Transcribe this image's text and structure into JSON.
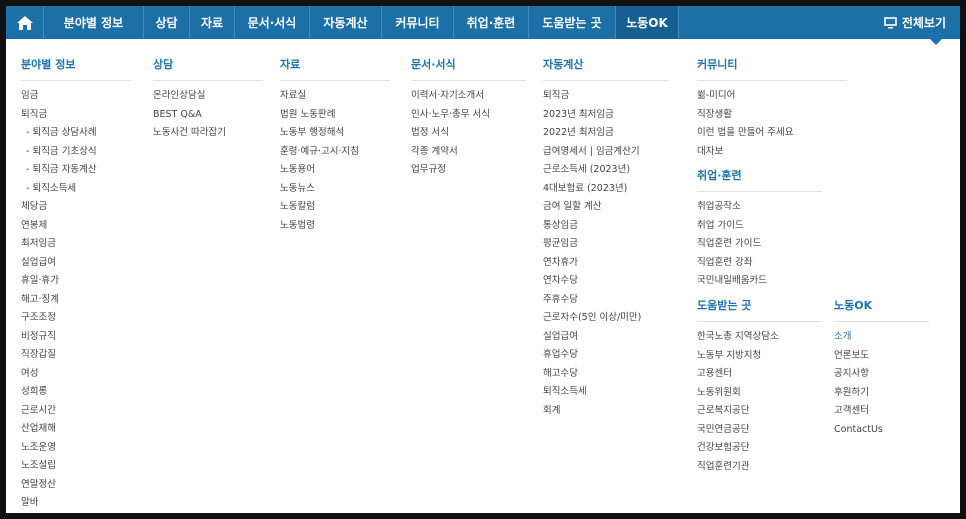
{
  "nav": {
    "items": [
      "분야별 정보",
      "상담",
      "자료",
      "문서·서식",
      "자동계산",
      "커뮤니티",
      "취업·훈련",
      "도움받는 곳",
      "노동OK"
    ],
    "full_view": "전체보기"
  },
  "menu": {
    "field": {
      "title": "분야별 정보",
      "items": [
        "임금",
        "퇴직금",
        "- 퇴직금 상담사례",
        "- 퇴직금 기초상식",
        "- 퇴직금 자동계산",
        "- 퇴직소득세",
        "체당금",
        "연봉제",
        "최저임금",
        "실업급여",
        "휴일·휴가",
        "해고·징계",
        "구조조정",
        "비정규직",
        "직장갑질",
        "여성",
        "성희롱",
        "근로시간",
        "산업재해",
        "노조운영",
        "노조설립",
        "연말정산",
        "알바"
      ]
    },
    "consult": {
      "title": "상담",
      "items": [
        "온라인상담실",
        "BEST Q&A",
        "노동사건 따라잡기"
      ]
    },
    "data": {
      "title": "자료",
      "items": [
        "자료실",
        "법원 노동판례",
        "노동부 행정해석",
        "훈령·예규·고시·지침",
        "노동용어",
        "노동뉴스",
        "노동칼럼",
        "노동법령"
      ]
    },
    "docs": {
      "title": "문서·서식",
      "items": [
        "이력서·자기소개서",
        "인사·노무·총무 서식",
        "법정 서식",
        "각종 계약서",
        "업무규정"
      ]
    },
    "calc": {
      "title": "자동계산",
      "items": [
        "퇴직금",
        "2023년 최저임금",
        "2022년 최저임금",
        "급여명세서 | 임금계산기",
        "근로소득세 (2023년)",
        "4대보험료 (2023년)",
        "금여 일할 계산",
        "통상임금",
        "평균임금",
        "연차휴가",
        "연차수당",
        "주휴수당",
        "근로자수(5인 이상/미만)",
        "실업급여",
        "휴업수당",
        "해고수당",
        "퇴직소득세",
        "회계"
      ]
    },
    "community": {
      "title": "커뮤니티",
      "items": [
        "쓂-미디어",
        "직장생활",
        "이런 법을 만들어 주세요",
        "대자보"
      ]
    },
    "jobs": {
      "title": "취업·훈련",
      "items": [
        "취업공작소",
        "취업 가이드",
        "직업훈련 가이드",
        "직업훈련 강좌",
        "국민내일배움카드"
      ]
    },
    "help": {
      "title": "도움받는 곳",
      "items": [
        "한국노총 지역상담소",
        "노동부 지방지청",
        "고용센터",
        "노동위원회",
        "근로복지공단",
        "국민연금공단",
        "건강보험공단",
        "직업훈련기관"
      ]
    },
    "nodongok": {
      "title": "노동OK",
      "items": [
        "소개",
        "언론보도",
        "공지사항",
        "후원하기",
        "고객센터",
        "ContactUs"
      ]
    }
  },
  "colors": {
    "nav_bg": "#1d6fa8",
    "accent": "#1f73ad"
  }
}
